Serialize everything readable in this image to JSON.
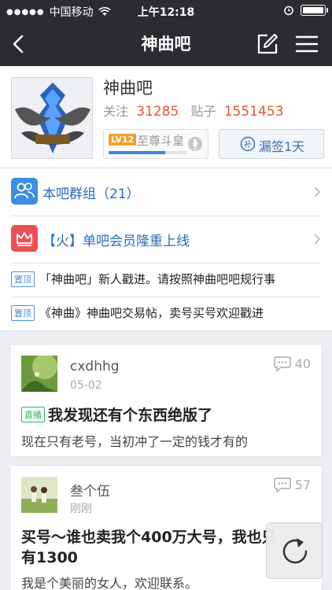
{
  "status_bar": {
    "carrier": "中国移动",
    "time": "上午12:18"
  },
  "nav": {
    "title": "神曲吧"
  },
  "forum": {
    "name": "神曲吧",
    "follow_label": "关注",
    "follow_count": "31285",
    "posts_label": "贴子",
    "posts_count": "1551453",
    "level_badge": "LV12",
    "level_name": "至尊斗皇",
    "level_progress": 0.72,
    "sign_label": "漏签1天",
    "sign_icon_char": "补"
  },
  "features": [
    {
      "label": "本吧群组（21）",
      "icon": "group-icon",
      "color": "#3d8ee0"
    },
    {
      "label": "【火】单吧会员隆重上线",
      "icon": "crown-icon",
      "color": "#ee4f53"
    }
  ],
  "pinned": {
    "tag": "置顶",
    "items": [
      "「神曲吧」新人戳进。请按照神曲吧吧规行事",
      "《神曲》神曲吧交易帖，卖号买号欢迎戳进"
    ]
  },
  "posts": [
    {
      "username": "cxdhhg",
      "date": "05-02",
      "replies": "40",
      "tag": "直播",
      "title": "我发现还有个东西绝版了",
      "body": "现在只有老号，当初冲了一定的钱才有的"
    },
    {
      "username": "叁个伍",
      "date": "刚刚",
      "replies": "57",
      "title_line1": "买号～谁也卖我个400万大号，我也只",
      "title_line2": "有1300",
      "body": "我是个美丽的女人，欢迎联系。"
    }
  ],
  "colors": {
    "nav_bg": "#2a2c30",
    "accent_number": "#e8552f",
    "link_blue": "#2a6db7",
    "live_green": "#2bb55c"
  }
}
